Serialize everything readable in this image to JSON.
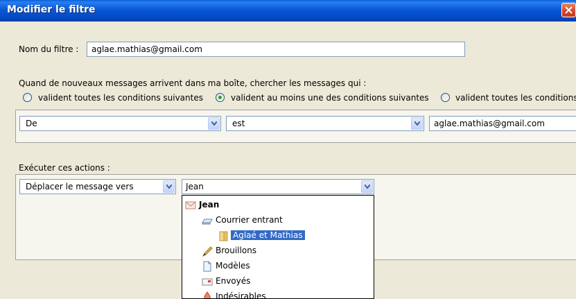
{
  "window": {
    "title": "Modifier le filtre"
  },
  "filter_name": {
    "label": "Nom du filtre :",
    "value": "aglae.mathias@gmail.com"
  },
  "conditions": {
    "intro": "Quand de nouveaux messages arrivent dans ma boîte, chercher les messages qui :",
    "options": [
      {
        "label": "valident toutes les conditions suivantes",
        "checked": false
      },
      {
        "label": "valident au moins une des conditions suivantes",
        "checked": true
      },
      {
        "label": "valident toutes les conditions",
        "checked": false
      }
    ],
    "rule": {
      "field": "De",
      "operator": "est",
      "value": "aglae.mathias@gmail.com"
    }
  },
  "actions": {
    "label": "Exécuter ces actions :",
    "action": "Déplacer le message vers",
    "target": "Jean"
  },
  "folder_menu": {
    "items": [
      {
        "label": "Jean",
        "icon": "account-icon",
        "level": 0,
        "bold": true
      },
      {
        "label": "Courrier entrant",
        "icon": "inbox-icon",
        "level": 1
      },
      {
        "label": "Aglaé et Mathias",
        "icon": "folder-icon",
        "level": 2,
        "selected": true
      },
      {
        "label": "Brouillons",
        "icon": "drafts-icon",
        "level": 1
      },
      {
        "label": "Modèles",
        "icon": "templates-icon",
        "level": 1
      },
      {
        "label": "Envoyés",
        "icon": "sent-icon",
        "level": 1
      },
      {
        "label": "Indésirables",
        "icon": "junk-icon",
        "level": 1
      }
    ]
  },
  "colors": {
    "titlebar": "#0a58d6",
    "selection": "#316ac5",
    "dialog": "#ece9d8"
  }
}
